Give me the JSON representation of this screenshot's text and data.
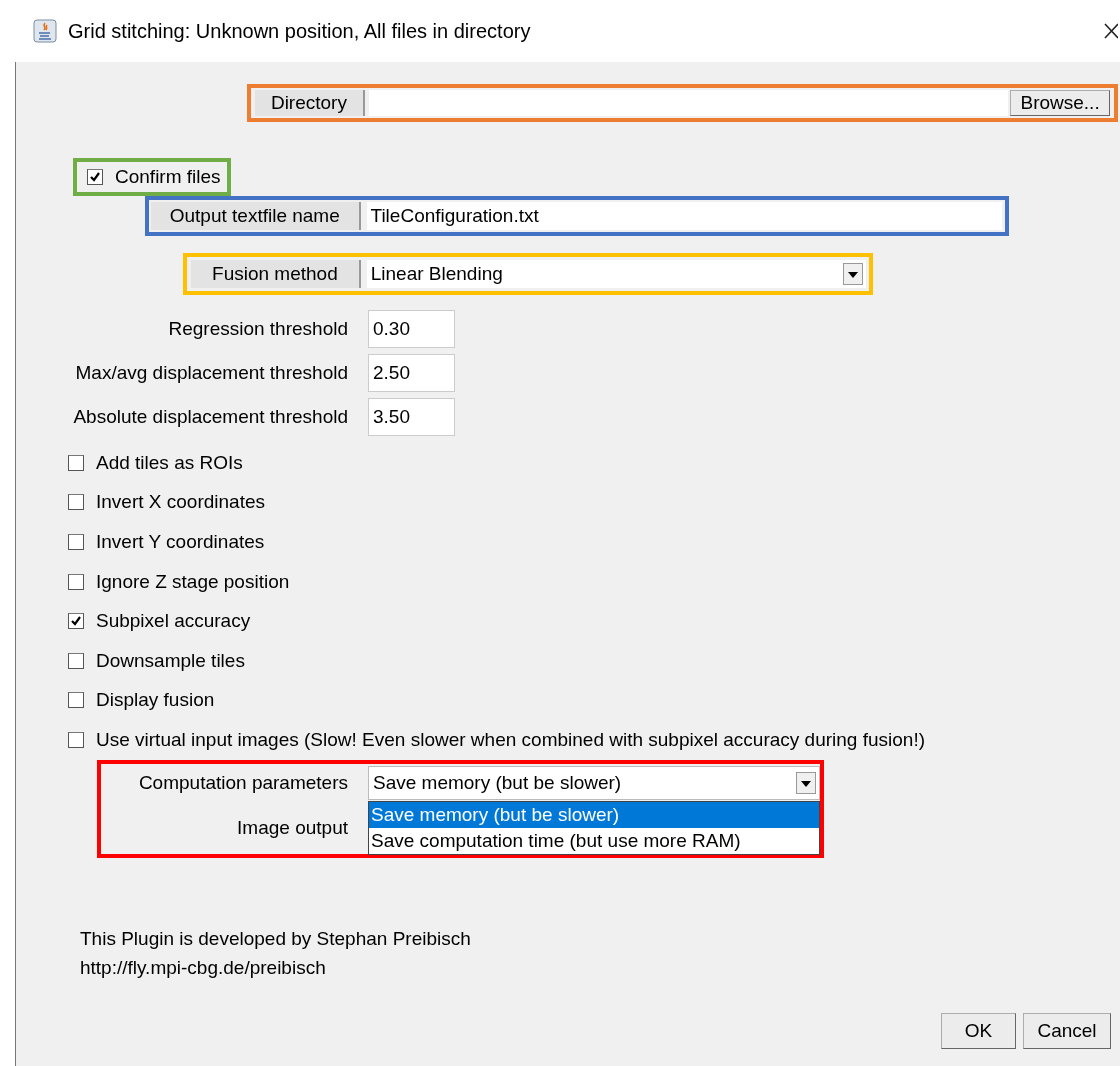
{
  "window": {
    "title": "Grid stitching: Unknown position, All files in directory"
  },
  "directory": {
    "label": "Directory",
    "button": "Browse...",
    "color": "#ed7d31"
  },
  "confirm_files": {
    "label": "Confirm files",
    "checked": true,
    "color": "#70ad47"
  },
  "output_file": {
    "label": "Output textfile name",
    "value": "TileConfiguration.txt",
    "color": "#4472c4"
  },
  "fusion": {
    "label": "Fusion method",
    "value": "Linear Blending",
    "color": "#ffc000"
  },
  "thresholds": [
    {
      "label": "Regression threshold",
      "value": "0.30"
    },
    {
      "label": "Max/avg displacement threshold",
      "value": "2.50"
    },
    {
      "label": "Absolute displacement threshold",
      "value": "3.50"
    }
  ],
  "options": [
    {
      "label": "Add tiles as ROIs",
      "checked": false
    },
    {
      "label": "Invert X coordinates",
      "checked": false
    },
    {
      "label": "Invert Y coordinates",
      "checked": false
    },
    {
      "label": "Ignore Z stage position",
      "checked": false
    },
    {
      "label": "Subpixel accuracy",
      "checked": true
    },
    {
      "label": "Downsample tiles",
      "checked": false
    },
    {
      "label": "Display fusion",
      "checked": false
    },
    {
      "label": "Use virtual input images (Slow! Even slower when combined with subpixel accuracy during fusion!)",
      "checked": false
    }
  ],
  "computation": {
    "label": "Computation parameters",
    "value": "Save memory (but be slower)",
    "color": "#ff0000",
    "options": [
      {
        "label": "Save memory (but be slower)",
        "selected": true
      },
      {
        "label": "Save computation time (but use more RAM)",
        "selected": false
      }
    ]
  },
  "image_output": {
    "label": "Image output"
  },
  "footer": [
    "This Plugin is developed by Stephan Preibisch",
    "http://fly.mpi-cbg.de/preibisch"
  ],
  "buttons": [
    "OK",
    "Cancel"
  ]
}
